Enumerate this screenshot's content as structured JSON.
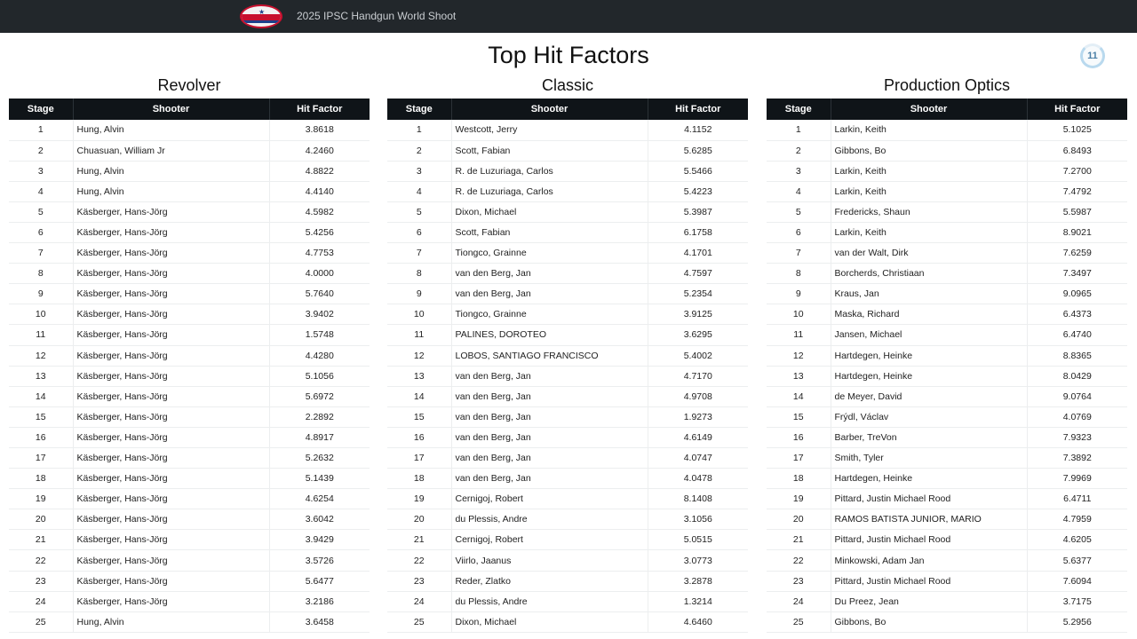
{
  "header": {
    "app_title": "2025 IPSC Handgun World Shoot",
    "logo_icon": "ipsc-logo-icon"
  },
  "page": {
    "title": "Top Hit Factors",
    "badge": "11"
  },
  "columns": {
    "stage": "Stage",
    "shooter": "Shooter",
    "hit_factor": "Hit Factor"
  },
  "panels": [
    {
      "title": "Revolver",
      "rows": [
        {
          "stage": "1",
          "shooter": "Hung, Alvin",
          "hf": "3.8618"
        },
        {
          "stage": "2",
          "shooter": "Chuasuan, William Jr",
          "hf": "4.2460"
        },
        {
          "stage": "3",
          "shooter": "Hung, Alvin",
          "hf": "4.8822"
        },
        {
          "stage": "4",
          "shooter": "Hung, Alvin",
          "hf": "4.4140"
        },
        {
          "stage": "5",
          "shooter": "Käsberger, Hans-Jörg",
          "hf": "4.5982"
        },
        {
          "stage": "6",
          "shooter": "Käsberger, Hans-Jörg",
          "hf": "5.4256"
        },
        {
          "stage": "7",
          "shooter": "Käsberger, Hans-Jörg",
          "hf": "4.7753"
        },
        {
          "stage": "8",
          "shooter": "Käsberger, Hans-Jörg",
          "hf": "4.0000"
        },
        {
          "stage": "9",
          "shooter": "Käsberger, Hans-Jörg",
          "hf": "5.7640"
        },
        {
          "stage": "10",
          "shooter": "Käsberger, Hans-Jörg",
          "hf": "3.9402"
        },
        {
          "stage": "11",
          "shooter": "Käsberger, Hans-Jörg",
          "hf": "1.5748"
        },
        {
          "stage": "12",
          "shooter": "Käsberger, Hans-Jörg",
          "hf": "4.4280"
        },
        {
          "stage": "13",
          "shooter": "Käsberger, Hans-Jörg",
          "hf": "5.1056"
        },
        {
          "stage": "14",
          "shooter": "Käsberger, Hans-Jörg",
          "hf": "5.6972"
        },
        {
          "stage": "15",
          "shooter": "Käsberger, Hans-Jörg",
          "hf": "2.2892"
        },
        {
          "stage": "16",
          "shooter": "Käsberger, Hans-Jörg",
          "hf": "4.8917"
        },
        {
          "stage": "17",
          "shooter": "Käsberger, Hans-Jörg",
          "hf": "5.2632"
        },
        {
          "stage": "18",
          "shooter": "Käsberger, Hans-Jörg",
          "hf": "5.1439"
        },
        {
          "stage": "19",
          "shooter": "Käsberger, Hans-Jörg",
          "hf": "4.6254"
        },
        {
          "stage": "20",
          "shooter": "Käsberger, Hans-Jörg",
          "hf": "3.6042"
        },
        {
          "stage": "21",
          "shooter": "Käsberger, Hans-Jörg",
          "hf": "3.9429"
        },
        {
          "stage": "22",
          "shooter": "Käsberger, Hans-Jörg",
          "hf": "3.5726"
        },
        {
          "stage": "23",
          "shooter": "Käsberger, Hans-Jörg",
          "hf": "5.6477"
        },
        {
          "stage": "24",
          "shooter": "Käsberger, Hans-Jörg",
          "hf": "3.2186"
        },
        {
          "stage": "25",
          "shooter": "Hung, Alvin",
          "hf": "3.6458"
        }
      ]
    },
    {
      "title": "Classic",
      "rows": [
        {
          "stage": "1",
          "shooter": "Westcott, Jerry",
          "hf": "4.1152"
        },
        {
          "stage": "2",
          "shooter": "Scott, Fabian",
          "hf": "5.6285"
        },
        {
          "stage": "3",
          "shooter": "R. de Luzuriaga, Carlos",
          "hf": "5.5466"
        },
        {
          "stage": "4",
          "shooter": "R. de Luzuriaga, Carlos",
          "hf": "5.4223"
        },
        {
          "stage": "5",
          "shooter": "Dixon, Michael",
          "hf": "5.3987"
        },
        {
          "stage": "6",
          "shooter": "Scott, Fabian",
          "hf": "6.1758"
        },
        {
          "stage": "7",
          "shooter": "Tiongco, Grainne",
          "hf": "4.1701"
        },
        {
          "stage": "8",
          "shooter": "van den Berg, Jan",
          "hf": "4.7597"
        },
        {
          "stage": "9",
          "shooter": "van den Berg, Jan",
          "hf": "5.2354"
        },
        {
          "stage": "10",
          "shooter": "Tiongco, Grainne",
          "hf": "3.9125"
        },
        {
          "stage": "11",
          "shooter": "PALINES, DOROTEO",
          "hf": "3.6295"
        },
        {
          "stage": "12",
          "shooter": "LOBOS, SANTIAGO FRANCISCO",
          "hf": "5.4002"
        },
        {
          "stage": "13",
          "shooter": "van den Berg, Jan",
          "hf": "4.7170"
        },
        {
          "stage": "14",
          "shooter": "van den Berg, Jan",
          "hf": "4.9708"
        },
        {
          "stage": "15",
          "shooter": "van den Berg, Jan",
          "hf": "1.9273"
        },
        {
          "stage": "16",
          "shooter": "van den Berg, Jan",
          "hf": "4.6149"
        },
        {
          "stage": "17",
          "shooter": "van den Berg, Jan",
          "hf": "4.0747"
        },
        {
          "stage": "18",
          "shooter": "van den Berg, Jan",
          "hf": "4.0478"
        },
        {
          "stage": "19",
          "shooter": "Cernigoj, Robert",
          "hf": "8.1408"
        },
        {
          "stage": "20",
          "shooter": "du Plessis, Andre",
          "hf": "3.1056"
        },
        {
          "stage": "21",
          "shooter": "Cernigoj, Robert",
          "hf": "5.0515"
        },
        {
          "stage": "22",
          "shooter": "Viirlo, Jaanus",
          "hf": "3.0773"
        },
        {
          "stage": "23",
          "shooter": "Reder, Zlatko",
          "hf": "3.2878"
        },
        {
          "stage": "24",
          "shooter": "du Plessis, Andre",
          "hf": "1.3214"
        },
        {
          "stage": "25",
          "shooter": "Dixon, Michael",
          "hf": "4.6460"
        }
      ]
    },
    {
      "title": "Production Optics",
      "rows": [
        {
          "stage": "1",
          "shooter": "Larkin, Keith",
          "hf": "5.1025"
        },
        {
          "stage": "2",
          "shooter": "Gibbons, Bo",
          "hf": "6.8493"
        },
        {
          "stage": "3",
          "shooter": "Larkin, Keith",
          "hf": "7.2700"
        },
        {
          "stage": "4",
          "shooter": "Larkin, Keith",
          "hf": "7.4792"
        },
        {
          "stage": "5",
          "shooter": "Fredericks, Shaun",
          "hf": "5.5987"
        },
        {
          "stage": "6",
          "shooter": "Larkin, Keith",
          "hf": "8.9021"
        },
        {
          "stage": "7",
          "shooter": "van der Walt, Dirk",
          "hf": "7.6259"
        },
        {
          "stage": "8",
          "shooter": "Borcherds, Christiaan",
          "hf": "7.3497"
        },
        {
          "stage": "9",
          "shooter": "Kraus, Jan",
          "hf": "9.0965"
        },
        {
          "stage": "10",
          "shooter": "Maska, Richard",
          "hf": "6.4373"
        },
        {
          "stage": "11",
          "shooter": "Jansen, Michael",
          "hf": "6.4740"
        },
        {
          "stage": "12",
          "shooter": "Hartdegen, Heinke",
          "hf": "8.8365"
        },
        {
          "stage": "13",
          "shooter": "Hartdegen, Heinke",
          "hf": "8.0429"
        },
        {
          "stage": "14",
          "shooter": "de Meyer, David",
          "hf": "9.0764"
        },
        {
          "stage": "15",
          "shooter": "Frýdl, Václav",
          "hf": "4.0769"
        },
        {
          "stage": "16",
          "shooter": "Barber, TreVon",
          "hf": "7.9323"
        },
        {
          "stage": "17",
          "shooter": "Smith, Tyler",
          "hf": "7.3892"
        },
        {
          "stage": "18",
          "shooter": "Hartdegen, Heinke",
          "hf": "7.9969"
        },
        {
          "stage": "19",
          "shooter": "Pittard, Justin Michael Rood",
          "hf": "6.4711"
        },
        {
          "stage": "20",
          "shooter": "RAMOS BATISTA JUNIOR, MARIO",
          "hf": "4.7959"
        },
        {
          "stage": "21",
          "shooter": "Pittard, Justin Michael Rood",
          "hf": "4.6205"
        },
        {
          "stage": "22",
          "shooter": "Minkowski, Adam Jan",
          "hf": "5.6377"
        },
        {
          "stage": "23",
          "shooter": "Pittard, Justin Michael Rood",
          "hf": "7.6094"
        },
        {
          "stage": "24",
          "shooter": "Du Preez, Jean",
          "hf": "3.7175"
        },
        {
          "stage": "25",
          "shooter": "Gibbons, Bo",
          "hf": "5.2956"
        }
      ]
    }
  ]
}
